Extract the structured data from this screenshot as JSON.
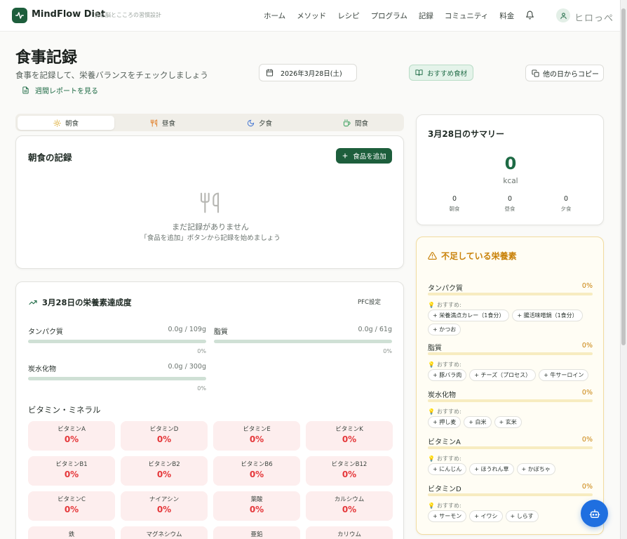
{
  "header": {
    "brand": "MindFlow Diet",
    "tagline": "食と脳とこころの習慣設計",
    "nav": [
      "ホーム",
      "メソッド",
      "レシピ",
      "プログラム",
      "記録",
      "コミュニティ",
      "料金"
    ],
    "username": "ヒロっぺ"
  },
  "page": {
    "title": "食事記録",
    "subtitle": "食事を記録して、栄養バランスをチェックしましょう",
    "weekly_report": "週間レポートを見る",
    "date": "2026年3月28日(土)",
    "recommend_button": "おすすめ食材",
    "copy_button": "他の日からコピー"
  },
  "meal_tabs": [
    {
      "label": "朝食",
      "icon": "sun-icon",
      "active": true
    },
    {
      "label": "昼食",
      "icon": "utensils-icon",
      "active": false
    },
    {
      "label": "夕食",
      "icon": "moon-icon",
      "active": false
    },
    {
      "label": "間食",
      "icon": "coffee-icon",
      "active": false
    }
  ],
  "breakfast": {
    "title": "朝食の記録",
    "add_button": "食品を追加",
    "empty_title": "まだ記録がありません",
    "empty_hint": "「食品を追加」ボタンから記録を始めましょう"
  },
  "nutrition": {
    "title": "3月28日の栄養素達成度",
    "pfc_settings": "PFC設定",
    "macros": [
      {
        "label": "タンパク質",
        "value": "0.0g / 109g",
        "pct": "0%",
        "progress": 0
      },
      {
        "label": "脂質",
        "value": "0.0g / 61g",
        "pct": "0%",
        "progress": 0
      },
      {
        "label": "炭水化物",
        "value": "0.0g / 300g",
        "pct": "0%",
        "progress": 0
      }
    ],
    "vitamins_title": "ビタミン・ミネラル",
    "vitamins": [
      {
        "name": "ビタミンA",
        "value": "0%"
      },
      {
        "name": "ビタミンD",
        "value": "0%"
      },
      {
        "name": "ビタミンE",
        "value": "0%"
      },
      {
        "name": "ビタミンK",
        "value": "0%"
      },
      {
        "name": "ビタミンB1",
        "value": "0%"
      },
      {
        "name": "ビタミンB2",
        "value": "0%"
      },
      {
        "name": "ビタミンB6",
        "value": "0%"
      },
      {
        "name": "ビタミンB12",
        "value": "0%"
      },
      {
        "name": "ビタミンC",
        "value": "0%"
      },
      {
        "name": "ナイアシン",
        "value": "0%"
      },
      {
        "name": "葉酸",
        "value": "0%"
      },
      {
        "name": "カルシウム",
        "value": "0%"
      },
      {
        "name": "鉄",
        "value": ""
      },
      {
        "name": "マグネシウム",
        "value": ""
      },
      {
        "name": "亜鉛",
        "value": ""
      },
      {
        "name": "カリウム",
        "value": ""
      }
    ]
  },
  "summary": {
    "title": "3月28日のサマリー",
    "kcal": "0",
    "unit": "kcal",
    "meals": [
      {
        "value": "0",
        "label": "朝食"
      },
      {
        "value": "0",
        "label": "昼食"
      },
      {
        "value": "0",
        "label": "夕食"
      }
    ]
  },
  "deficits": {
    "title": "不足している栄養素",
    "recommend_label": "おすすめ:",
    "items": [
      {
        "name": "タンパク質",
        "pct": "0%",
        "foods": [
          "+ 栄養満点カレー（1食分）",
          "+ 腸活味噌鍋（1食分）",
          "+ かつお"
        ]
      },
      {
        "name": "脂質",
        "pct": "0%",
        "foods": [
          "+ 豚バラ肉",
          "+ チーズ（プロセス）",
          "+ 牛サーロイン"
        ]
      },
      {
        "name": "炭水化物",
        "pct": "0%",
        "foods": [
          "+ 押し麦",
          "+ 白米",
          "+ 玄米"
        ]
      },
      {
        "name": "ビタミンA",
        "pct": "0%",
        "foods": [
          "+ にんじん",
          "+ ほうれん草",
          "+ かぼちゃ"
        ]
      },
      {
        "name": "ビタミンD",
        "pct": "0%",
        "foods": [
          "+ サーモン",
          "+ イワシ",
          "+ しらす"
        ]
      }
    ]
  },
  "colors": {
    "brand": "#1d5e3c",
    "accent_green": "#1d6a44",
    "warning": "#c9820a",
    "danger": "#e5383b",
    "fab": "#1f6fe0"
  }
}
